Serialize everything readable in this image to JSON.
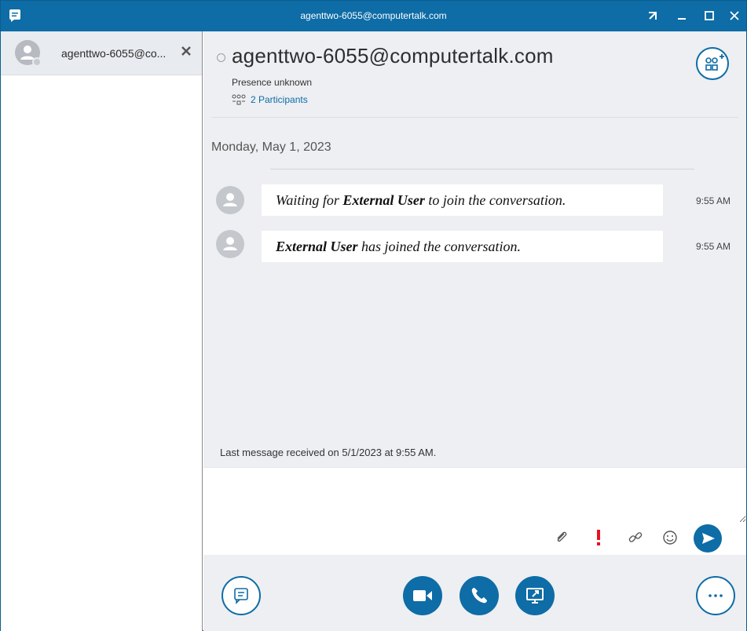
{
  "window": {
    "title": "agenttwo-6055@computertalk.com",
    "accent": "#0e6ca6"
  },
  "sidebar": {
    "conversations": [
      {
        "name": "agenttwo-6055@co...",
        "icon": "close-x-icon"
      }
    ]
  },
  "header": {
    "contact_name": "agenttwo-6055@computertalk.com",
    "presence": "Presence unknown",
    "participants_label": "2 Participants"
  },
  "conversation": {
    "date_label": "Monday, May 1, 2023",
    "messages": [
      {
        "prefix": "Waiting for ",
        "bold": "External User",
        "suffix": " to join the conversation.",
        "time": "9:55 AM"
      },
      {
        "prefix": "",
        "bold": "External User",
        "suffix": " has joined the conversation.",
        "time": "9:55 AM"
      }
    ],
    "last_received": "Last message received on 5/1/2023 at 9:55 AM."
  },
  "compose": {
    "placeholder": "",
    "tools": [
      "attach-icon",
      "important-icon",
      "link-icon",
      "emoji-icon",
      "send-icon"
    ]
  },
  "bottom_bar": {
    "buttons": [
      "conversation-icon",
      "video-icon",
      "call-icon",
      "present-screen-icon",
      "more-options-icon"
    ]
  }
}
